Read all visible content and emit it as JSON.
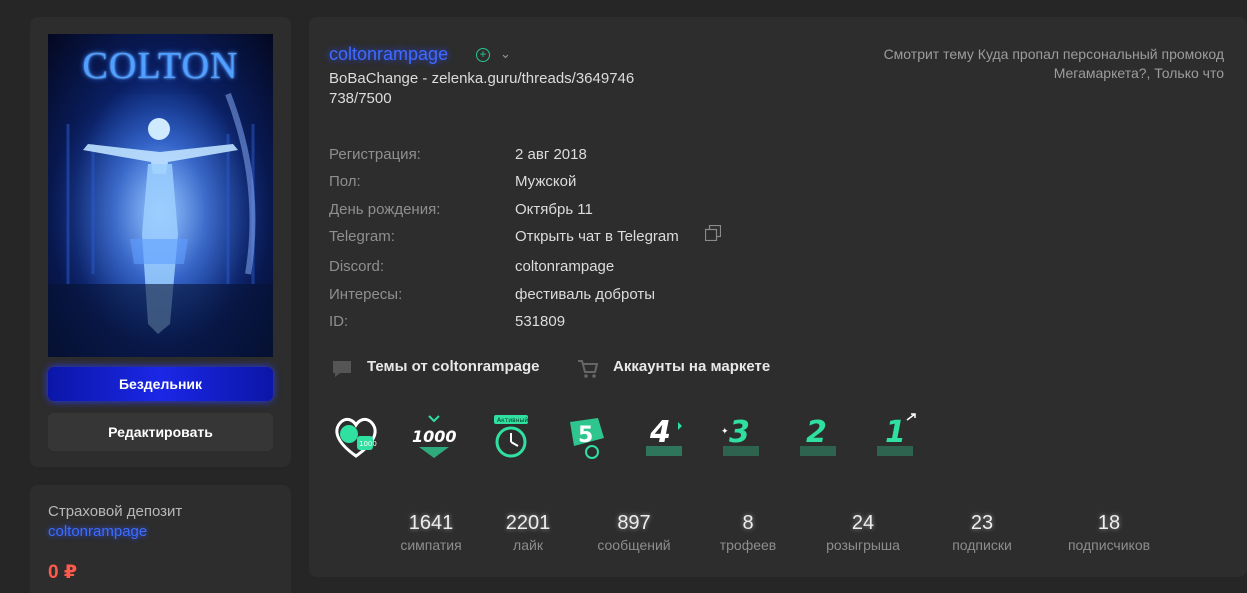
{
  "avatar": {
    "title": "COLTON"
  },
  "sidebar": {
    "rank_label": "Бездельник",
    "edit_label": "Редактировать",
    "deposit": {
      "title": "Страховой депозит",
      "user": "coltonrampage",
      "amount": "0 ₽"
    }
  },
  "profile": {
    "username": "coltonrampage",
    "online_icon": "plus-circle-icon",
    "status_line1": "BoBaChange - zelenka.guru/threads/3649746",
    "status_line2": "738/7500",
    "activity": "Смотрит тему Куда пропал персональный промокод Мегамаркета?, Только что"
  },
  "info": [
    {
      "label": "Регистрация:",
      "value": "2 авг 2018"
    },
    {
      "label": "Пол:",
      "value": "Мужской"
    },
    {
      "label": "День рождения:",
      "value": "Октябрь 11"
    },
    {
      "label": "Telegram:",
      "value": "Открыть чат в Telegram"
    },
    {
      "label": "Discord:",
      "value": "coltonrampage"
    },
    {
      "label": "Интересы:",
      "value": "фестиваль доброты"
    },
    {
      "label": "ID:",
      "value": "531809"
    }
  ],
  "links": {
    "threads": "Темы от coltonrampage",
    "market": "Аккаунты на маркете"
  },
  "trophies": [
    {
      "icon": "heart-1000-trophy-icon",
      "text": "1000"
    },
    {
      "icon": "sympathy-1000-trophy-icon",
      "text": "1000"
    },
    {
      "icon": "active-stopwatch-trophy-icon",
      "text": "Активный"
    },
    {
      "icon": "five-years-trophy-icon",
      "text": "5"
    },
    {
      "icon": "four-years-trophy-icon",
      "text": "4"
    },
    {
      "icon": "three-years-trophy-icon",
      "text": "3"
    },
    {
      "icon": "two-years-trophy-icon",
      "text": "2"
    },
    {
      "icon": "one-year-trophy-icon",
      "text": "1"
    }
  ],
  "stats": [
    {
      "value": "1641",
      "label": "симпатия"
    },
    {
      "value": "2201",
      "label": "лайк"
    },
    {
      "value": "897",
      "label": "сообщений"
    },
    {
      "value": "8",
      "label": "трофеев"
    },
    {
      "value": "24",
      "label": "розыгрыша"
    },
    {
      "value": "23",
      "label": "подписки"
    },
    {
      "value": "18",
      "label": "подписчиков"
    }
  ],
  "colors": {
    "accent": "#3f6bff",
    "trophy": "#2fe0a0",
    "deposit": "#ff5a4a"
  }
}
